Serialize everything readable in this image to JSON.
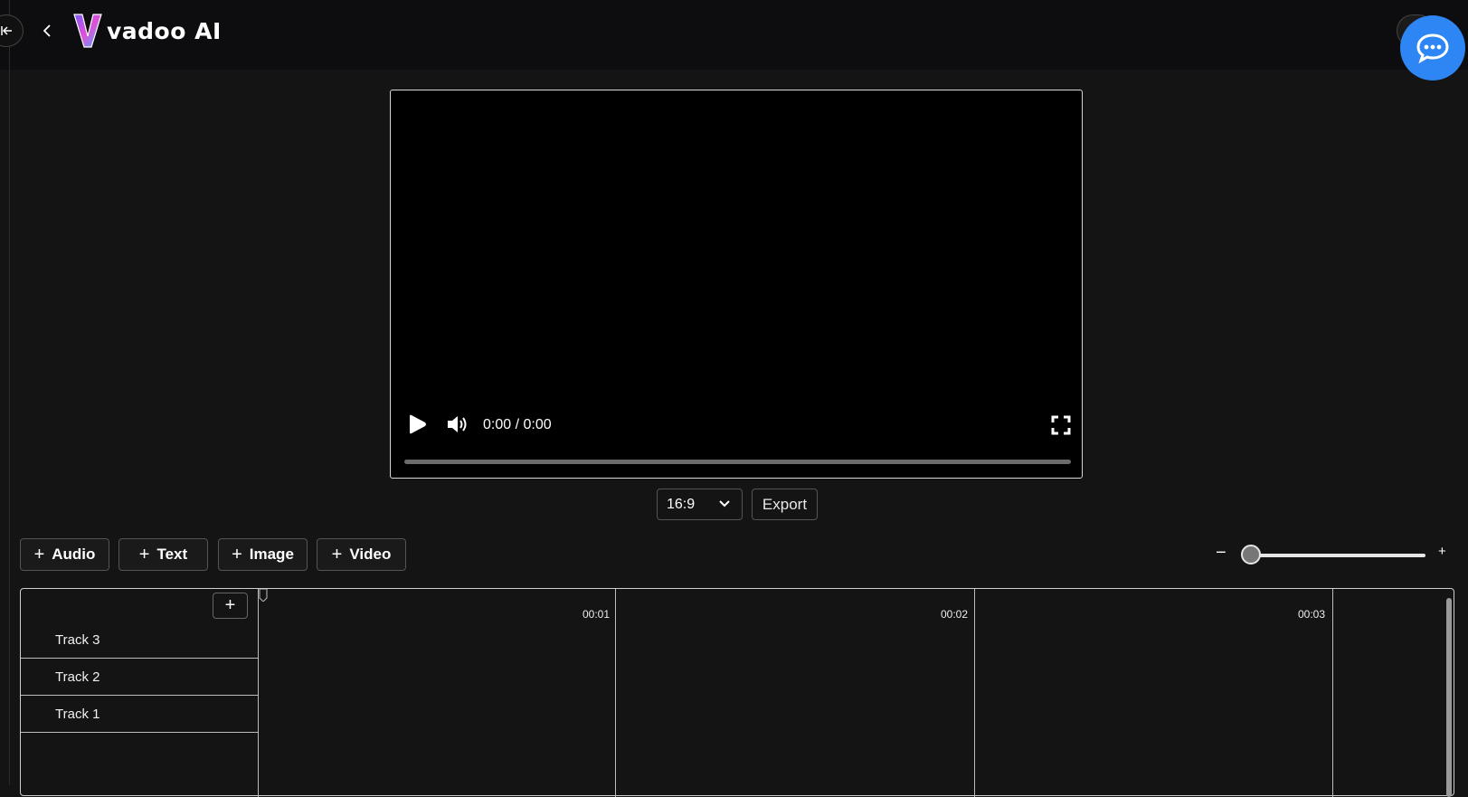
{
  "header": {
    "brand": "vadoo AI",
    "collapse_icon": "collapse-left-icon",
    "back_icon": "chevron-left-icon",
    "chat_icon": "chat-bubble-icon"
  },
  "player": {
    "time": "0:00 / 0:00",
    "play_icon": "play-icon",
    "volume_icon": "volume-icon",
    "fullscreen_icon": "fullscreen-icon"
  },
  "controls": {
    "aspect_ratio": "16:9",
    "export_label": "Export"
  },
  "add_buttons": [
    {
      "label": "Audio"
    },
    {
      "label": "Text"
    },
    {
      "label": "Image"
    },
    {
      "label": "Video"
    }
  ],
  "zoom": {
    "minus": "−",
    "plus": "+",
    "level": 0
  },
  "timeline": {
    "add_track": "+",
    "tracks": [
      "Track 3",
      "Track 2",
      "Track 1"
    ],
    "ticks": [
      "00:01",
      "00:02",
      "00:03"
    ]
  },
  "colors": {
    "accent": "#2e86f4",
    "background": "#141414"
  }
}
